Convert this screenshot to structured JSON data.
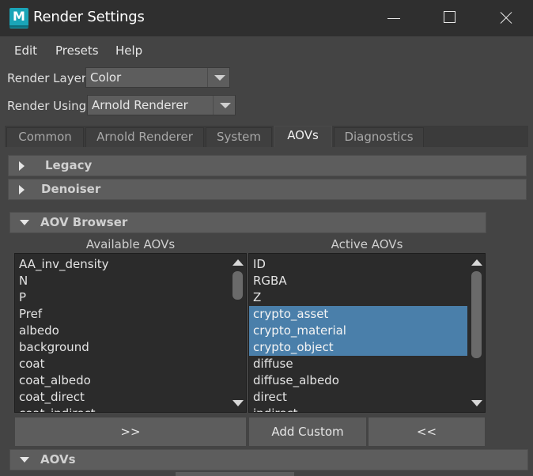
{
  "window": {
    "title": "Render Settings",
    "logo_letter": "M"
  },
  "menu": {
    "items": [
      "Edit",
      "Presets",
      "Help"
    ]
  },
  "render_layer": {
    "label": "Render Layer",
    "value": "Color"
  },
  "render_using": {
    "label": "Render Using",
    "value": "Arnold Renderer"
  },
  "tabs": [
    {
      "label": "Common",
      "active": false
    },
    {
      "label": "Arnold Renderer",
      "active": false
    },
    {
      "label": "System",
      "active": false
    },
    {
      "label": "AOVs",
      "active": true
    },
    {
      "label": "Diagnostics",
      "active": false
    }
  ],
  "sections": {
    "legacy": "Legacy",
    "denoiser": "Denoiser",
    "aov_browser": "AOV Browser",
    "aovs": "AOVs"
  },
  "browser": {
    "available_header": "Available AOVs",
    "active_header": "Active AOVs",
    "available": [
      "AA_inv_density",
      "N",
      "P",
      "Pref",
      "albedo",
      "background",
      "coat",
      "coat_albedo",
      "coat_direct",
      "coat_indirect"
    ],
    "active": [
      "ID",
      "RGBA",
      "Z",
      "crypto_asset",
      "crypto_material",
      "crypto_object",
      "diffuse",
      "diffuse_albedo",
      "direct",
      "indirect"
    ],
    "active_selected": [
      "crypto_asset",
      "crypto_material",
      "crypto_object"
    ]
  },
  "buttons": {
    "add": ">>",
    "add_custom": "Add Custom",
    "remove": "<<"
  },
  "colors": {
    "selection": "#4a7faa",
    "logo": "#1aa5b8"
  }
}
